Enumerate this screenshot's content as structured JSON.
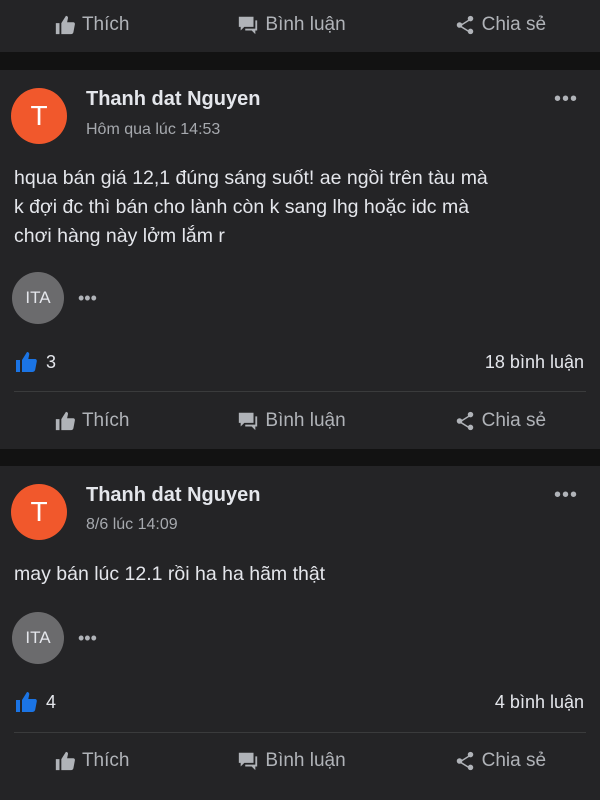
{
  "top_actions": {
    "like": "Thích",
    "comment": "Bình luận",
    "share": "Chia sẻ"
  },
  "posts": [
    {
      "avatar_letter": "T",
      "author": "Thanh dat Nguyen",
      "time": "Hôm qua lúc 14:53",
      "more": "•••",
      "body_lines": [
        "hqua bán giá 12,1 đúng sáng suốt! ae ngồi trên tàu mà",
        "k đợi đc thì bán cho lành còn k sang lhg hoặc idc mà",
        "chơi hàng này lởm lắm r"
      ],
      "reply_avatar": "ITA",
      "reply_more": "•••",
      "likes": "3",
      "comments": "18 bình luận",
      "actions": {
        "like": "Thích",
        "comment": "Bình luận",
        "share": "Chia sẻ"
      }
    },
    {
      "avatar_letter": "T",
      "author": "Thanh dat Nguyen",
      "time": "8/6 lúc 14:09",
      "more": "•••",
      "body_lines": [
        "may bán lúc 12.1 rồi ha ha hãm thật"
      ],
      "reply_avatar": "ITA",
      "reply_more": "•••",
      "likes": "4",
      "comments": "4 bình luận",
      "actions": {
        "like": "Thích",
        "comment": "Bình luận",
        "share": "Chia sẻ"
      }
    }
  ],
  "colors": {
    "like_blue": "#1b74e4",
    "avatar_orange": "#f1582c"
  }
}
